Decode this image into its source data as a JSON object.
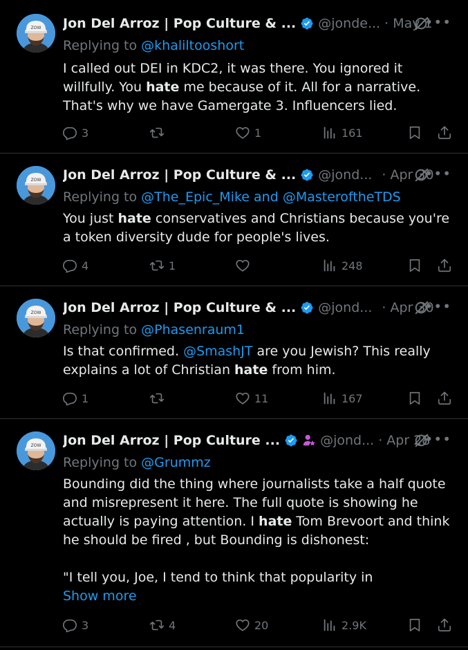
{
  "author": {
    "name_full": "Jon Del Arroz | Pop Culture & ...",
    "name_short": "Jon Del Arroz | Pop Culture ...",
    "handle_1": "@jonde...",
    "handle_2": "@jond..."
  },
  "tweets": [
    {
      "date": "· May 1",
      "replying_prefix": "Replying to ",
      "replying_to": "@khaliltooshort",
      "body": {
        "p1": "I called out DEI in KDC2, it was there. You ignored it willfully. You ",
        "hl": "hate",
        "p2": " me because of it. All for a narrative. That's why we have Gamergate 3. Influencers lied."
      },
      "stats": {
        "replies": "3",
        "reposts": "",
        "likes": "1",
        "views": "161"
      }
    },
    {
      "date": "· Apr 30",
      "replying_prefix": "Replying to ",
      "replying_to": "@The_Epic_Mike",
      "replying_and": " and ",
      "replying_to_2": "@MasteroftheTDS",
      "body": {
        "p1": "You just ",
        "hl": "hate",
        "p2": " conservatives and Christians because you're a token diversity dude for people's lives."
      },
      "stats": {
        "replies": "4",
        "reposts": "1",
        "likes": "",
        "views": "248"
      }
    },
    {
      "date": "· Apr 30",
      "replying_prefix": "Replying to ",
      "replying_to": "@Phasenraum1",
      "body": {
        "p1": "Is that confirmed. ",
        "mention": "@SmashJT",
        "p2": " are you Jewish? This really explains a lot of Christian ",
        "hl": "hate",
        "p3": " from him."
      },
      "stats": {
        "replies": "1",
        "reposts": "",
        "likes": "11",
        "views": "167"
      }
    },
    {
      "date": "· Apr 28",
      "replying_prefix": "Replying to ",
      "replying_to": "@Grummz",
      "body": {
        "p1": "Bounding did the thing where journalists take a half quote and misrepresent it here. The full quote is showing he actually is paying attention. I ",
        "hl": "hate",
        "p2": " Tom Brevoort and think he should be fired , but Bounding is dishonest:",
        "quote": "\"I tell you, Joe, I tend to think that popularity in",
        "show_more": "Show more"
      },
      "stats": {
        "replies": "3",
        "reposts": "4",
        "likes": "20",
        "views": "2.9K"
      }
    }
  ],
  "colors": {
    "background": "#000000",
    "text": "#e7e9ea",
    "muted": "#71767b",
    "link": "#1d9bf0",
    "divider": "#2f3336",
    "badge_purple": "#c659d9"
  },
  "icons": [
    "verified-badge-icon",
    "grok-icon",
    "more-icon",
    "reply-icon",
    "repost-icon",
    "like-icon",
    "views-icon",
    "bookmark-icon",
    "share-icon",
    "affiliate-badge-icon"
  ]
}
